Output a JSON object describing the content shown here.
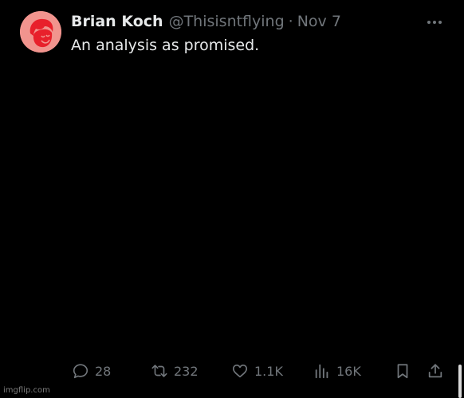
{
  "tweet": {
    "author_name": "Brian Koch",
    "handle": "@Thisisntflying",
    "separator": "·",
    "date": "Nov 7",
    "text": "An analysis as promised.",
    "avatar_icon": "cartoon-face-avatar",
    "avatar_color": "#f1948e",
    "more_icon": "more-horizontal-icon",
    "actions": {
      "replies": "28",
      "retweets": "232",
      "likes": "1.1K",
      "views": "16K"
    }
  },
  "watermark": "imgflip.com",
  "colors": {
    "background": "#000000",
    "primary_text": "#e7e9ea",
    "secondary_text": "#71767b"
  }
}
